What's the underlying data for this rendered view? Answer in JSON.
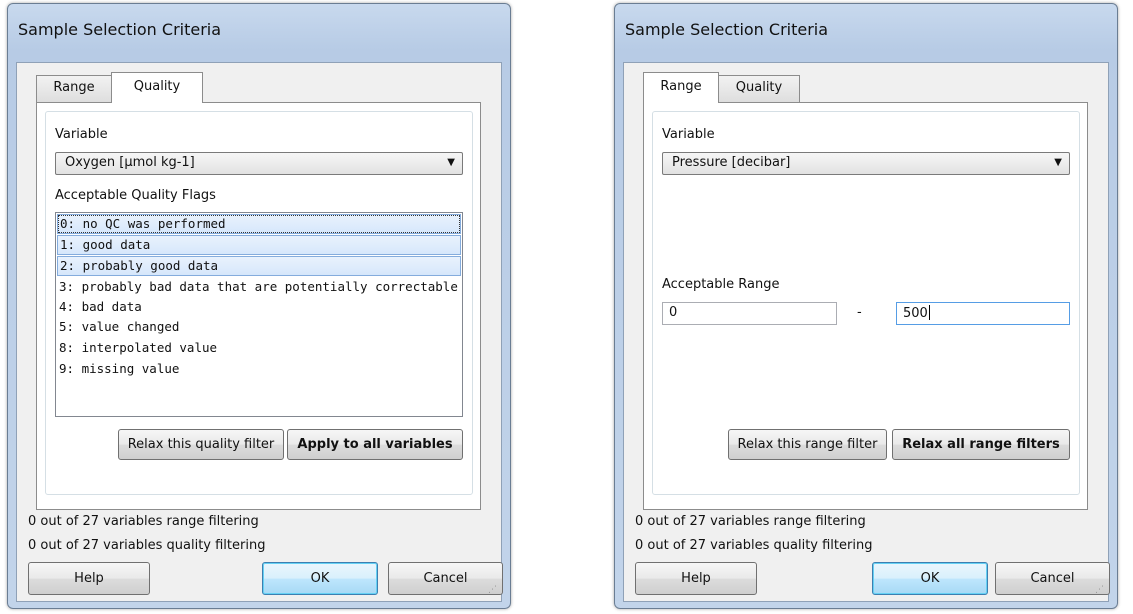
{
  "left_dialog": {
    "title": "Sample Selection Criteria",
    "tabs": [
      {
        "label": "Range",
        "active": false
      },
      {
        "label": "Quality",
        "active": true
      }
    ],
    "variable_label": "Variable",
    "variable_value": "Oxygen [µmol kg-1]",
    "flags_label": "Acceptable Quality Flags",
    "flags": [
      {
        "text": "0: no QC was performed",
        "selected": true
      },
      {
        "text": "1: good data",
        "selected": true
      },
      {
        "text": "2: probably good data",
        "selected": true
      },
      {
        "text": "3: probably bad data that are potentially correctable",
        "selected": false
      },
      {
        "text": "4: bad data",
        "selected": false
      },
      {
        "text": "5: value changed",
        "selected": false
      },
      {
        "text": "8: interpolated value",
        "selected": false
      },
      {
        "text": "9: missing value",
        "selected": false
      }
    ],
    "relax_button": "Relax this quality filter",
    "apply_all_button": "Apply to all variables",
    "status_range": "0 out of 27 variables range filtering",
    "status_quality": "0 out of 27 variables quality filtering",
    "help_button": "Help",
    "ok_button": "OK",
    "cancel_button": "Cancel"
  },
  "right_dialog": {
    "title": "Sample Selection Criteria",
    "tabs": [
      {
        "label": "Range",
        "active": true
      },
      {
        "label": "Quality",
        "active": false
      }
    ],
    "variable_label": "Variable",
    "variable_value": "Pressure [decibar]",
    "range_label": "Acceptable Range",
    "range_min": "0",
    "range_separator": "-",
    "range_max": "500",
    "relax_button": "Relax this range filter",
    "relax_all_button": "Relax all range filters",
    "status_range": "0 out of 27 variables range filtering",
    "status_quality": "0 out of 27 variables quality filtering",
    "help_button": "Help",
    "ok_button": "OK",
    "cancel_button": "Cancel"
  },
  "colors": {
    "title_gradient": "#b7cbe5",
    "selection_fill": "#d6e7fb",
    "focus_border": "#569de5"
  }
}
